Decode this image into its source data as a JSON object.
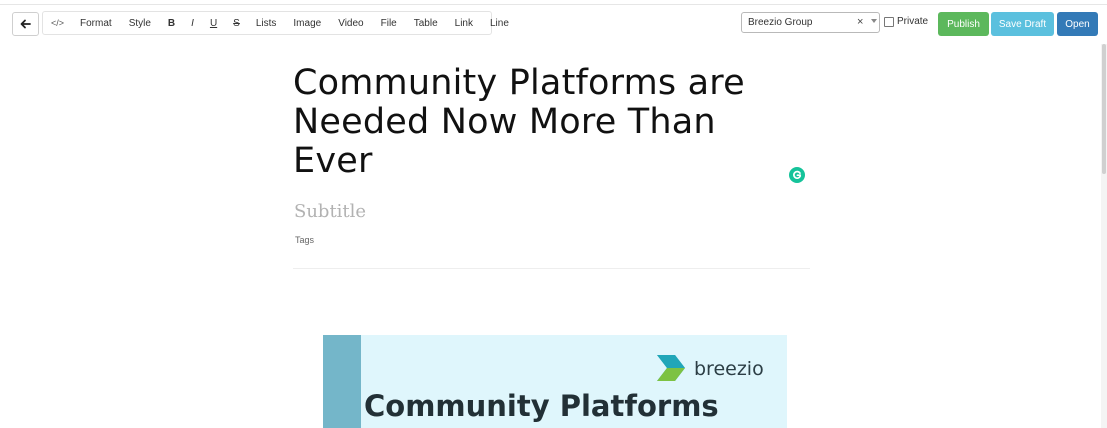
{
  "toolbar": {
    "code": "</>",
    "format": "Format",
    "style": "Style",
    "bold": "B",
    "italic": "I",
    "underline": "U",
    "strike": "S",
    "lists": "Lists",
    "image": "Image",
    "video": "Video",
    "file": "File",
    "table": "Table",
    "link": "Link",
    "line": "Line"
  },
  "group_select": {
    "value": "Breezio Group",
    "clear": "×"
  },
  "private": {
    "label": "Private",
    "checked": false
  },
  "actions": {
    "publish": "Publish",
    "save_draft": "Save Draft",
    "open": "Open"
  },
  "colors": {
    "publish": "#5cb85c",
    "save_draft": "#5bc0de",
    "open": "#337ab7",
    "grammarly": "#15c39a"
  },
  "post": {
    "title": "Community Platforms are Needed Now More Than Ever",
    "subtitle_placeholder": "Subtitle",
    "tags_placeholder": "Tags"
  },
  "cover_image": {
    "logo_text": "breezio",
    "headline": "Community Platforms"
  },
  "icons": [
    "back-arrow-icon",
    "chevron-down-icon",
    "grammarly-icon",
    "breezio-logo-icon"
  ]
}
